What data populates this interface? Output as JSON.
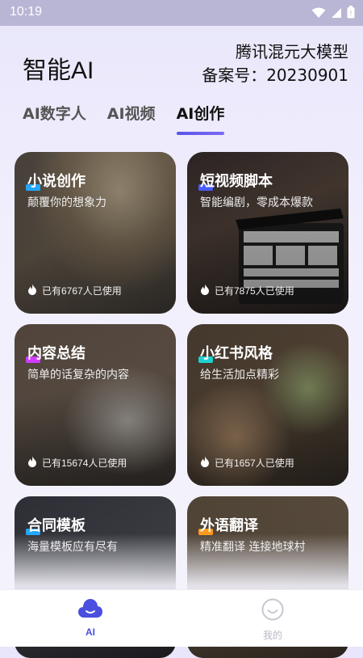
{
  "status_bar": {
    "time": "10:19"
  },
  "header": {
    "app_title": "智能AI",
    "model_name": "腾讯混元大模型",
    "filing": "备案号：20230901"
  },
  "tabs": [
    {
      "label": "AI数字人",
      "active": false
    },
    {
      "label": "AI视频",
      "active": false
    },
    {
      "label": "AI创作",
      "active": true
    }
  ],
  "cards": [
    {
      "title": "小说创作",
      "subtitle": "颠覆你的想象力",
      "usage": "已有6767人已使用",
      "accent": "#23a7ff"
    },
    {
      "title": "短视频脚本",
      "subtitle": "智能编剧，零成本爆款",
      "usage": "已有7875人已使用",
      "accent": "#4a5bff"
    },
    {
      "title": "内容总结",
      "subtitle": "简单的话复杂的内容",
      "usage": "已有15674人已使用",
      "accent": "#d23cff"
    },
    {
      "title": "小红书风格",
      "subtitle": "给生活加点精彩",
      "usage": "已有1657人已使用",
      "accent": "#1fd0d0"
    },
    {
      "title": "合同模板",
      "subtitle": "海量模板应有尽有",
      "usage": "",
      "accent": "#23a7ff"
    },
    {
      "title": "外语翻译",
      "subtitle": "精准翻译 连接地球村",
      "usage": "",
      "accent": "#ff9a1f"
    }
  ],
  "bottom_nav": [
    {
      "label": "AI",
      "active": true
    },
    {
      "label": "我的",
      "active": false
    }
  ],
  "colors": {
    "primary": "#4a4fe0",
    "inactive": "#b9b9c6"
  }
}
